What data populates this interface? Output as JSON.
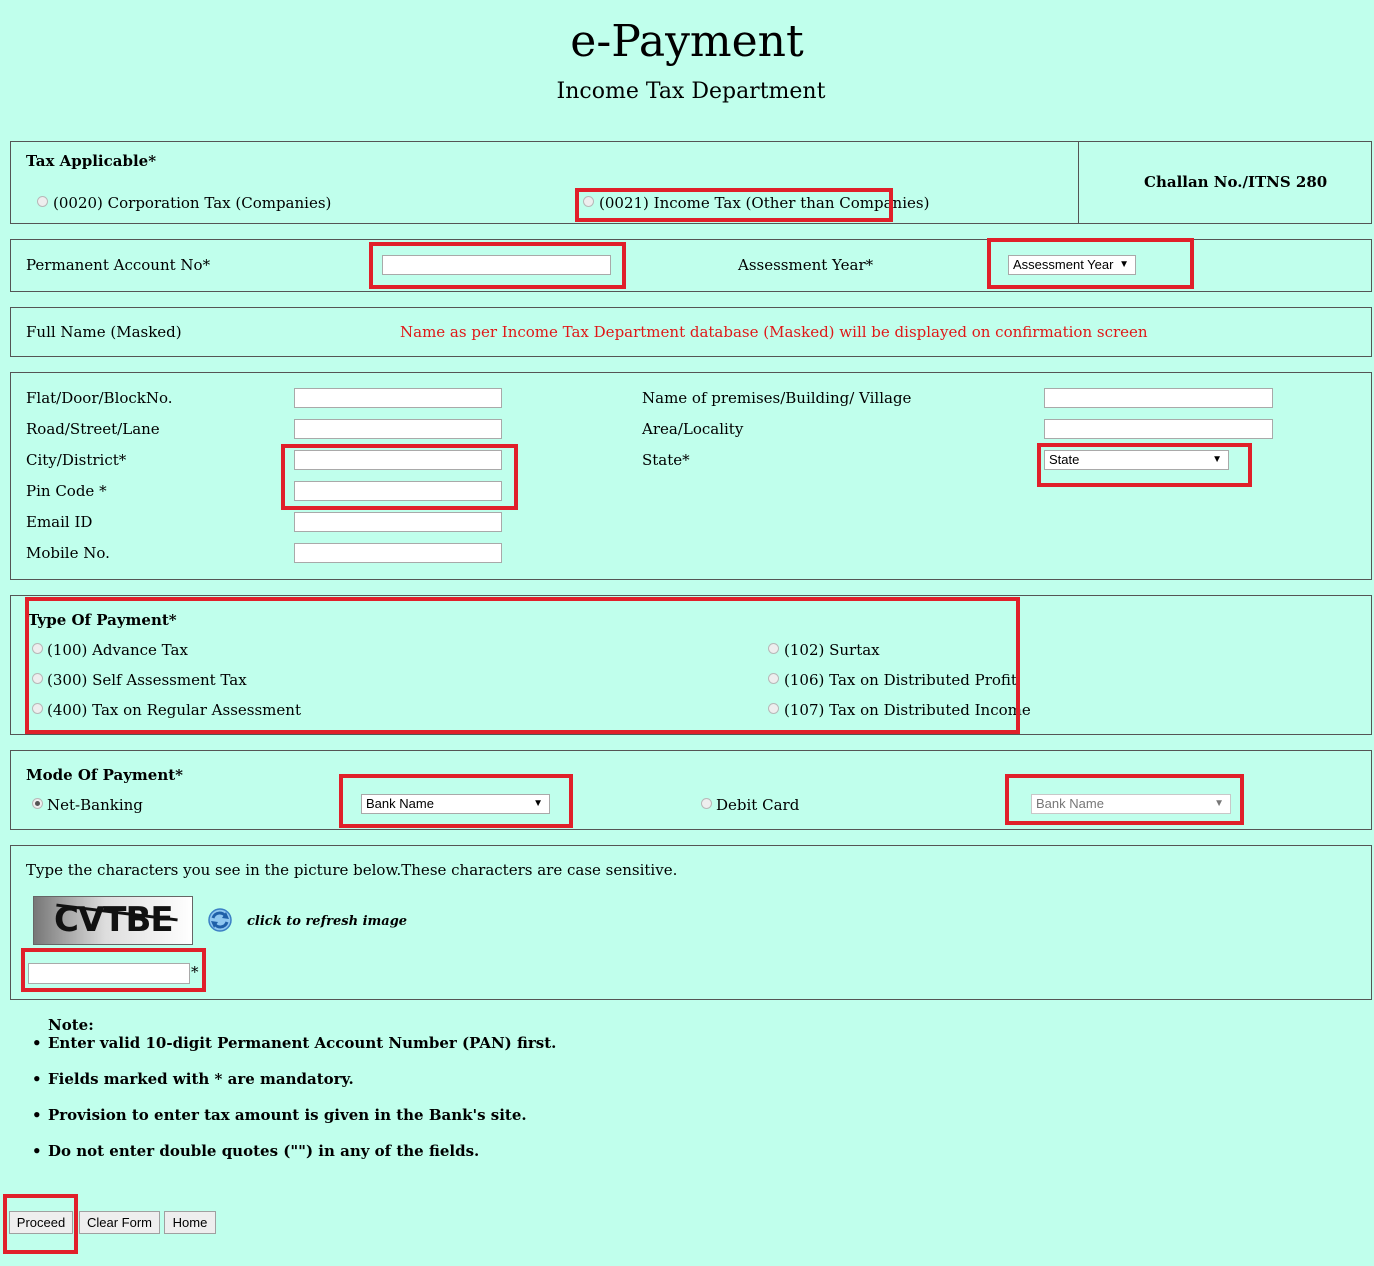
{
  "header": {
    "title": "e-Payment",
    "subtitle": "Income Tax Department"
  },
  "tax_section": {
    "label": "Tax Applicable*",
    "option_corp": "(0020) Corporation Tax (Companies)",
    "option_income": "(0021) Income Tax (Other than Companies)",
    "challan": "Challan No./ITNS 280"
  },
  "pan_section": {
    "pan_label": "Permanent Account No*",
    "pan_value": "",
    "ay_label": "Assessment Year*",
    "ay_select": "Assessment Year"
  },
  "name_section": {
    "label": "Full Name (Masked)",
    "note": "Name as per Income Tax Department database (Masked) will be displayed on confirmation screen"
  },
  "address": {
    "flat_label": "Flat/Door/BlockNo.",
    "road_label": "Road/Street/Lane",
    "city_label": "City/District*",
    "pin_label": "Pin Code *",
    "email_label": "Email ID",
    "mobile_label": "Mobile No.",
    "premises_label": "Name of premises/Building/ Village",
    "area_label": "Area/Locality",
    "state_label": "State*",
    "state_select": "State"
  },
  "payment_type": {
    "label": "Type Of Payment*",
    "options": [
      "(100) Advance Tax",
      "(300) Self Assessment Tax",
      "(400) Tax on Regular Assessment",
      "(102) Surtax",
      "(106) Tax on Distributed Profit",
      "(107) Tax on Distributed Income"
    ]
  },
  "payment_mode": {
    "label": "Mode Of Payment*",
    "netbanking": "Net-Banking",
    "netbanking_selected": true,
    "bank_select": "Bank Name",
    "debit": "Debit Card",
    "debit_bank_select": "Bank Name"
  },
  "captcha": {
    "instruction": "Type the characters you see in the picture below.These characters are case sensitive.",
    "image_text": "CVTBE",
    "refresh_label": "click to refresh image",
    "required_mark": "*",
    "value": ""
  },
  "notes": {
    "heading": "Note:",
    "items": [
      "Enter valid 10-digit Permanent Account Number (PAN) first.",
      "Fields marked with * are mandatory.",
      "Provision to enter tax amount is given in the Bank's site.",
      "Do not enter double quotes (\"\") in any of the fields."
    ]
  },
  "buttons": {
    "proceed": "Proceed",
    "clear": "Clear Form",
    "home": "Home"
  },
  "colors": {
    "background": "#c0ffec",
    "highlight": "#e0202a",
    "note_red": "#e01818"
  }
}
